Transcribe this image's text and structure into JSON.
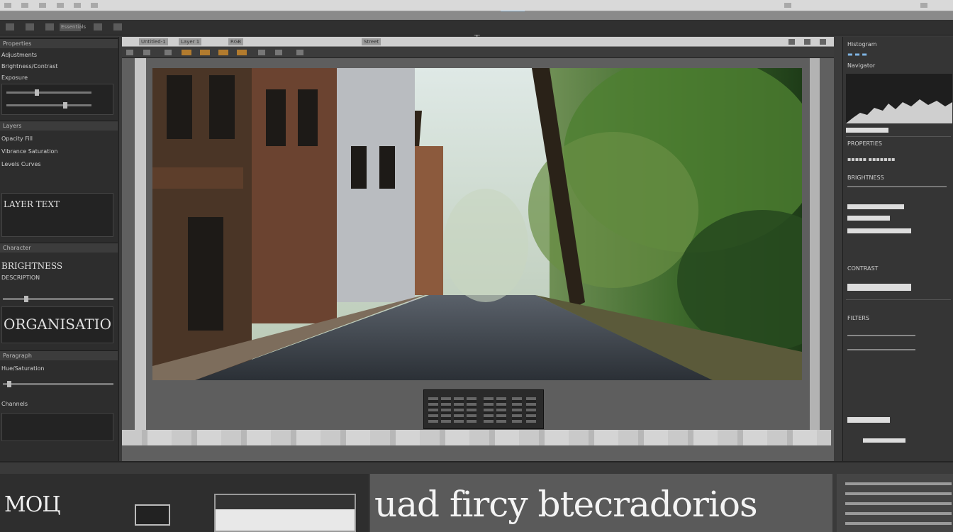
{
  "app": {
    "workspace_label": "Essentials"
  },
  "center": {
    "tabs": [
      "Untitled-1",
      "Layer 1",
      "RGB"
    ],
    "document_status": "Street"
  },
  "left_panel": {
    "header1": "Properties",
    "row1": "Adjustments",
    "row2": "Brightness/Contrast",
    "row3": "Exposure",
    "header2": "Layers",
    "row4": "Opacity Fill",
    "row5": "Vibrance Saturation",
    "row6": "Levels Curves",
    "big1": "LAYER TEXT",
    "header3": "Character",
    "big2": "BRIGHTNESS",
    "row7": "DESCRIPTION",
    "big3": "ORGANISATIO",
    "header4": "Paragraph",
    "row8": "Hue/Saturation",
    "row9": "Channels"
  },
  "right_panel": {
    "title1": "Histogram",
    "title2": "Navigator",
    "label1": "PROPERTIES",
    "label2": "BRIGHTNESS",
    "label3": "CONTRAST",
    "label4": "FILTERS"
  },
  "bottom": {
    "left_text": "МОЦ",
    "title": "uad fircy btecradorios"
  },
  "colors": {
    "accent": "#b27b2e",
    "selection": "#9fc8ea"
  }
}
